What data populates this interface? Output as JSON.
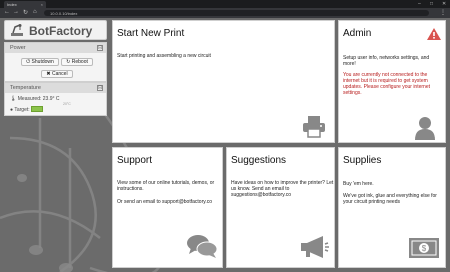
{
  "browser": {
    "tab_title": "Index",
    "tab_close": "×",
    "url": "10.0.0.10/index",
    "nav": {
      "back": "←",
      "forward": "→",
      "reload": "↻",
      "home": "⌂"
    },
    "window_controls": {
      "minimize": "–",
      "maximize": "□",
      "close": "✕"
    },
    "menu": "⋮"
  },
  "logo": {
    "text": "BotFactory"
  },
  "power": {
    "title": "Power",
    "collapse": "⊟",
    "shutdown": {
      "icon": "⏻",
      "label": "Shutdown"
    },
    "reboot": {
      "icon": "↻",
      "label": "Reboot"
    },
    "cancel": {
      "icon": "✖",
      "label": "Cancel"
    }
  },
  "temperature": {
    "title": "Temperature",
    "collapse": "⊟",
    "measured_label": "Measured:",
    "measured_value": "23.9° C",
    "measured_note": "20°C",
    "target_label": "Target:"
  },
  "cards": {
    "start": {
      "title": "Start New Print",
      "text": "Start printing and assembling a new circuit",
      "icon": "printer-icon"
    },
    "admin": {
      "title": "Admin",
      "text": "Setup user info, networks settings, and more!",
      "warning": "You are currently not connected to the internet but it is required to get system updates. Please configure your internet settings.",
      "icon": "user-icon",
      "alert_icon": "warning-icon"
    },
    "support": {
      "title": "Support",
      "text1": "View some of our online tutorials, demos, or instructions.",
      "text2": "Or send an email to support@botfactory.co",
      "icon": "chat-bubbles-icon"
    },
    "suggestions": {
      "title": "Suggestions",
      "text": "Have ideas on how to improve the printer? Let us know. Send an email to suggestions@botfactory.co",
      "icon": "megaphone-icon"
    },
    "supplies": {
      "title": "Supplies",
      "text1": "Buy 'em here.",
      "text2": "We've got ink, glue and everything else for your circuit printing needs",
      "icon": "money-icon"
    }
  },
  "colors": {
    "accent_green": "#8bc34a",
    "warning_red": "#b71c1c",
    "alert_icon_red": "#d9534f"
  }
}
